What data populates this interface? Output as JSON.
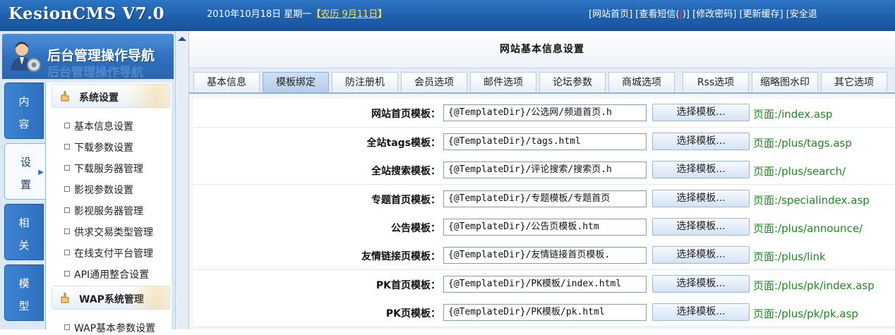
{
  "header": {
    "brand": "KesionCMS V7.0",
    "date": "2010年10月18日 星期一",
    "lunar_open": "【",
    "lunar": "农历 9月11日",
    "lunar_close": "】",
    "links": [
      "[网站首页]",
      "[查看短信(",
      ")]",
      "[修改密码]",
      "[更新缓存]",
      "[安全退"
    ]
  },
  "sidebar": {
    "title": "后台管理操作导航",
    "ghost": "后台管理操作导航",
    "vtabs": [
      {
        "chars": [
          "内",
          "容"
        ]
      },
      {
        "chars": [
          "设",
          "置"
        ]
      },
      {
        "chars": [
          "相",
          "关"
        ]
      },
      {
        "chars": [
          "模",
          "型"
        ]
      }
    ],
    "groups": [
      {
        "label": "系统设置"
      },
      {
        "label": "WAP系统管理"
      }
    ],
    "items": [
      "基本信息设置",
      "下载参数设置",
      "下载服务器管理",
      "影视参数设置",
      "影视服务器管理",
      "供求交易类型管理",
      "在线支付平台管理",
      "API通用整合设置",
      "WAP基本参数设置"
    ]
  },
  "main": {
    "title": "网站基本信息设置",
    "tabs": [
      "基本信息",
      "模板绑定",
      "防注册机",
      "会员选项",
      "邮件选项",
      "论坛参数",
      "商城选项",
      "Rss选项",
      "缩略图水印",
      "其它选项"
    ],
    "active_tab": "模板绑定",
    "button_label": "选择模板...",
    "rows": [
      {
        "label": "网站首页模板：",
        "value": "{@TemplateDir}/公选网/频道首页.h",
        "page": "页面:/index.asp"
      },
      {
        "label": "全站tags模板：",
        "value": "{@TemplateDir}/tags.html",
        "page": "页面:/plus/tags.asp"
      },
      {
        "label": "全站搜索模板：",
        "value": "{@TemplateDir}/评论搜索/搜索页.h",
        "page": "页面:/plus/search/"
      },
      {
        "label": "专题首页模板：",
        "value": "{@TemplateDir}/专题模板/专题首页",
        "page": "页面:/specialindex.asp"
      },
      {
        "label": "公告模板：",
        "value": "{@TemplateDir}/公告页模板.htm",
        "page": "页面:/plus/announce/"
      },
      {
        "label": "友情链接页模板：",
        "value": "{@TemplateDir}/友情链接首页模板.",
        "page": "页面:/plus/link"
      },
      {
        "label": "PK首页模板：",
        "value": "{@TemplateDir}/PK模板/index.html",
        "page": "页面:/plus/pk/index.asp"
      },
      {
        "label": "PK页模板：",
        "value": "{@TemplateDir}/PK模板/pk.html",
        "page": "页面:/plus/pk/pk.asp"
      }
    ]
  },
  "colors": {
    "header": "#1d5eaa",
    "accent": "#2d6fbf",
    "page_link": "#1b8a1b"
  }
}
